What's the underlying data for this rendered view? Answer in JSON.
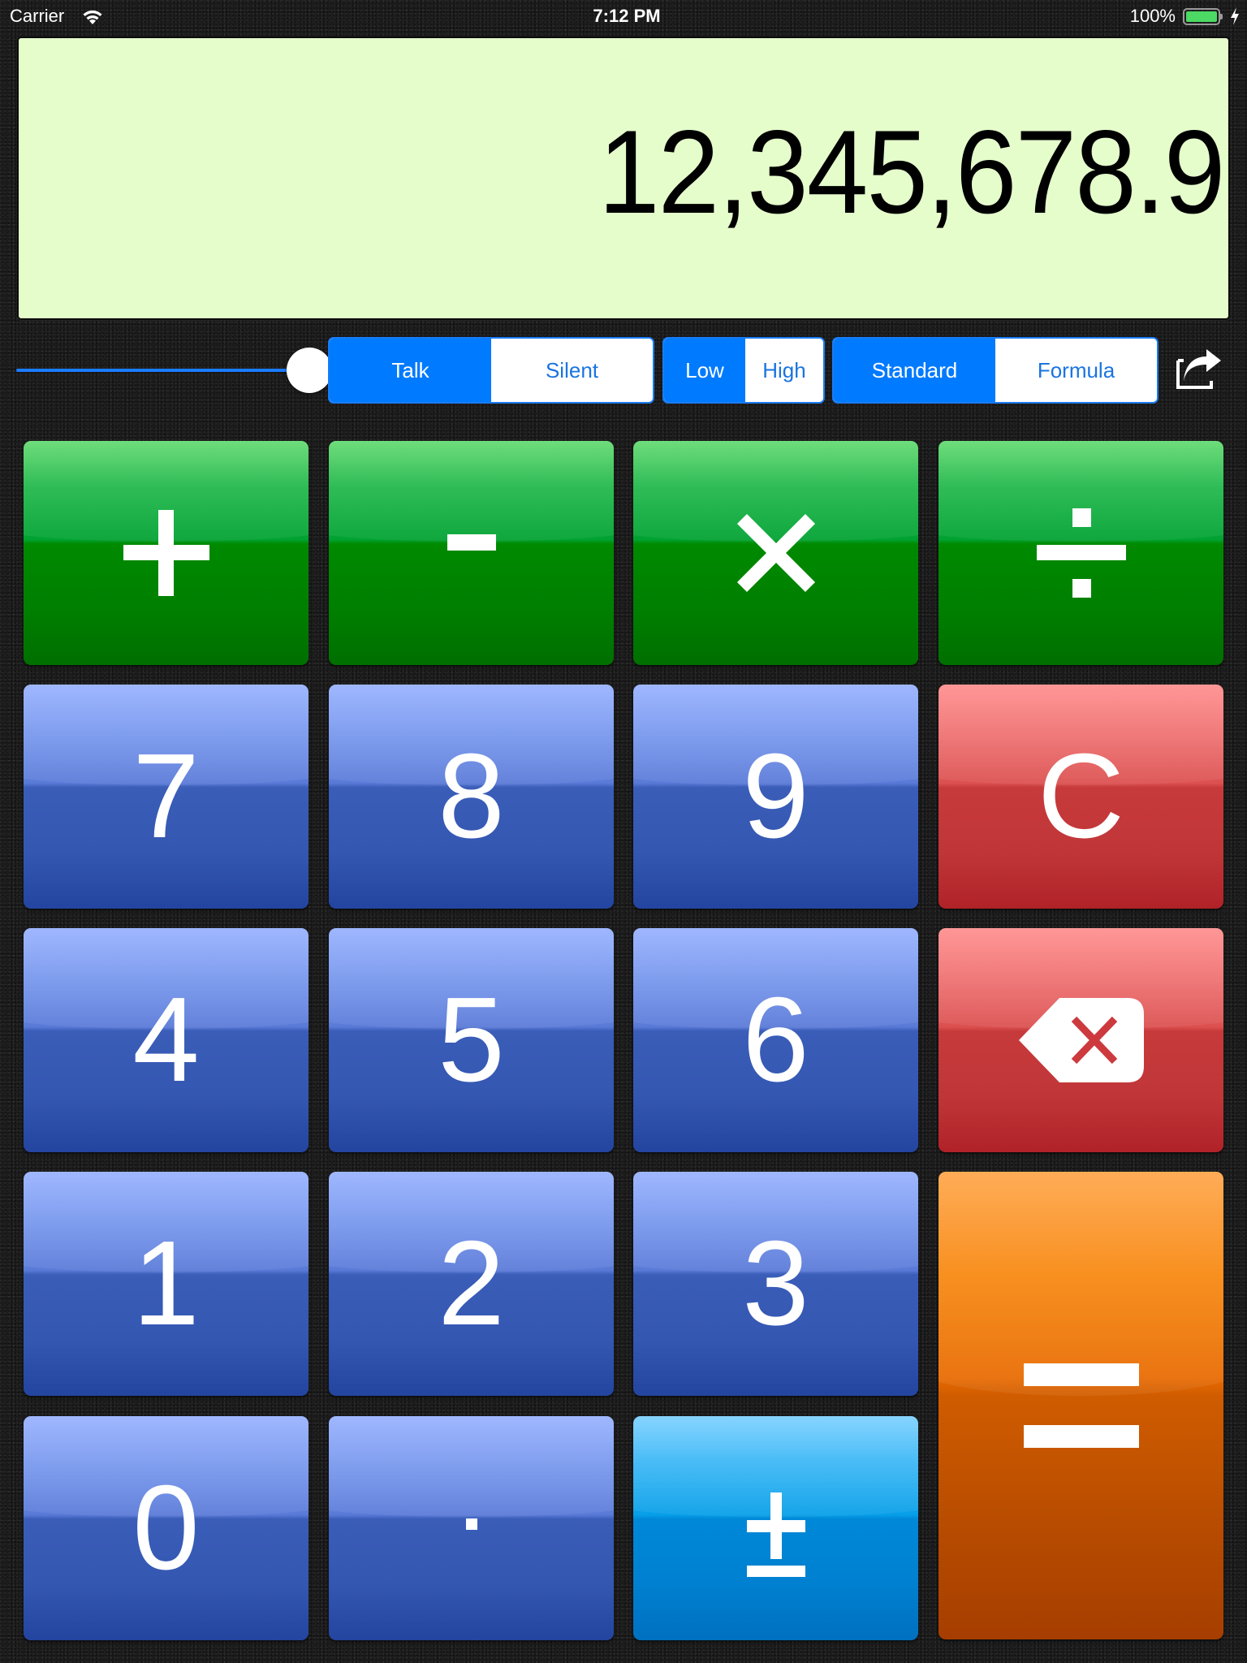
{
  "status_bar": {
    "carrier": "Carrier",
    "time": "7:12 PM",
    "battery_percent": "100%",
    "battery_level": 1.0,
    "charging": true,
    "icons": [
      "wifi-icon",
      "battery-icon",
      "charging-bolt-icon"
    ]
  },
  "display": {
    "value": "12,345,678.9",
    "background_color": "#e5fccb"
  },
  "volume_slider": {
    "value": 1.0,
    "accent_color": "#1b7cff"
  },
  "segmented_controls": {
    "sound": {
      "options": [
        "Talk",
        "Silent"
      ],
      "selected": "Talk"
    },
    "pitch": {
      "options": [
        "Low",
        "High"
      ],
      "selected": "Low"
    },
    "mode": {
      "options": [
        "Standard",
        "Formula"
      ],
      "selected": "Standard"
    },
    "accent_color": "#007aff"
  },
  "share_button": {
    "icon": "share-icon"
  },
  "keypad": {
    "operators": {
      "add": "+",
      "subtract": "-",
      "multiply": "×",
      "divide": "÷"
    },
    "digits": {
      "d7": "7",
      "d8": "8",
      "d9": "9",
      "d4": "4",
      "d5": "5",
      "d6": "6",
      "d1": "1",
      "d2": "2",
      "d3": "3",
      "d0": "0"
    },
    "clear": "C",
    "backspace_icon": "backspace-icon",
    "decimal": ".",
    "plus_minus": "±",
    "equals": "=",
    "colors": {
      "operator": "#008a00",
      "digit": "#3a5db8",
      "clear": "#c73a3c",
      "plus_minus": "#0088d8",
      "equals": "#e86a00"
    }
  }
}
